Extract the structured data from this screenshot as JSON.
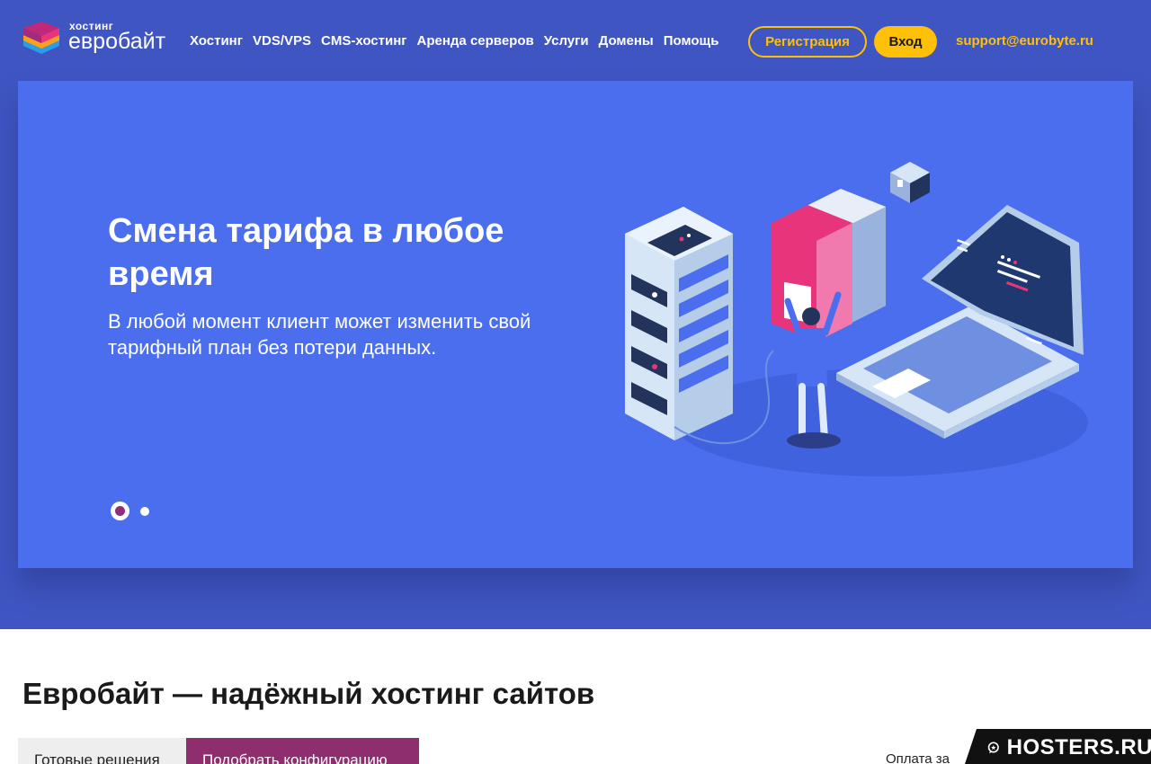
{
  "header": {
    "logo_small": "хостинг",
    "logo_big": "евробайт",
    "nav": [
      "Хостинг",
      "VDS/VPS",
      "CMS-хостинг",
      "Аренда серверов",
      "Услуги",
      "Домены",
      "Помощь"
    ],
    "register_label": "Регистрация",
    "login_label": "Вход",
    "email": "support@eurobyte.ru"
  },
  "hero": {
    "title": "Смена тарифа в любое время",
    "text": "В любой момент клиент может изменить свой тарифный план без потери данных.",
    "slides_count": 2,
    "active_slide": 1
  },
  "main": {
    "title": "Евробайт — надёжный хостинг сайтов",
    "tabs": [
      "Готовые решения",
      "Подобрать конфигурацию"
    ],
    "active_tab": 2,
    "payment_label": "Оплата за"
  },
  "watermark": {
    "text": "HOSTERS.RU"
  },
  "colors": {
    "header_bg": "#3f55c2",
    "hero_bg": "#4a6eee",
    "accent_yellow": "#ffc107",
    "accent_purple": "#8e2e6e"
  }
}
